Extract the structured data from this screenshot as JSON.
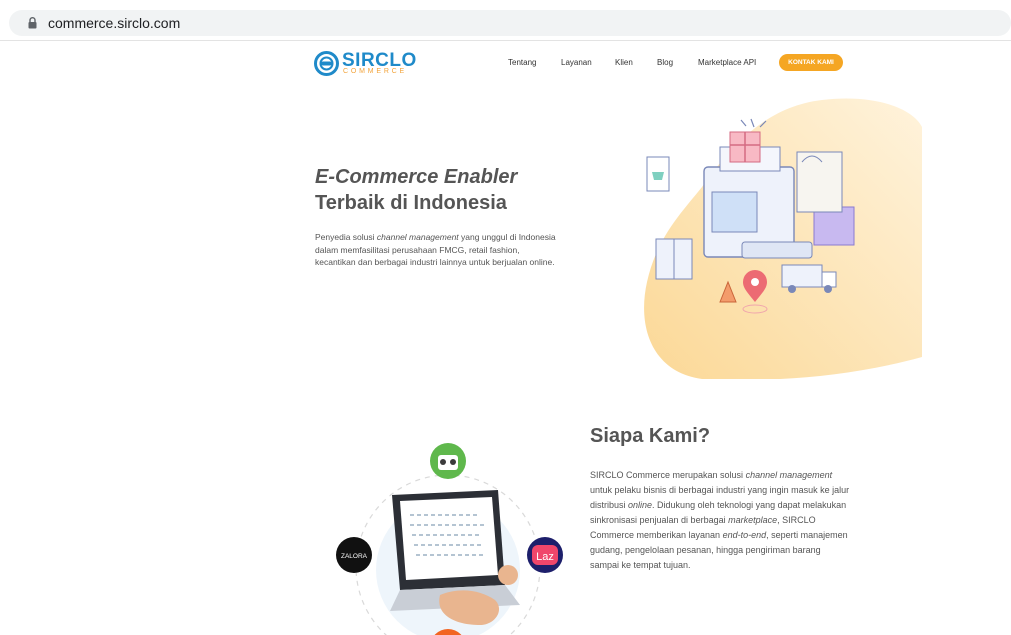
{
  "browser": {
    "url": "commerce.sirclo.com"
  },
  "brand": {
    "name": "SIRCLO",
    "sub": "COMMERCE"
  },
  "nav": {
    "items": [
      "Tentang",
      "Layanan",
      "Klien",
      "Blog",
      "Marketplace API"
    ],
    "cta": "KONTAK KAMI"
  },
  "hero": {
    "title_italic": "E-Commerce Enabler",
    "title_rest": "Terbaik di Indonesia",
    "lead_a": "Penyedia solusi ",
    "lead_em": "channel management",
    "lead_b": " yang unggul di Indonesia dalam memfasilitasi perusahaan FMCG, retail fashion, kecantikan dan berbagai industri lainnya untuk berjualan online."
  },
  "about": {
    "title": "Siapa Kami?",
    "p1": "SIRCLO Commerce merupakan solusi ",
    "em1": "channel management",
    "p2": " untuk pelaku bisnis di berbagai industri yang ingin masuk ke jalur distribusi ",
    "em2": "online",
    "p3": ". Didukung oleh teknologi yang dapat melakukan sinkronisasi penjualan di berbagai ",
    "em3": "marketplace",
    "p4": ", SIRCLO Commerce memberikan layanan ",
    "em4": "end-to-end",
    "p5": ", seperti manajemen gudang, pengelolaan pesanan, hingga pengiriman barang sampai ke tempat tujuan."
  },
  "partners": {
    "zalora": "ZALORA",
    "lazada": "Laz"
  },
  "colors": {
    "accent": "#f5a623",
    "brand": "#1f8ac9",
    "blob": "#fde7bf"
  }
}
